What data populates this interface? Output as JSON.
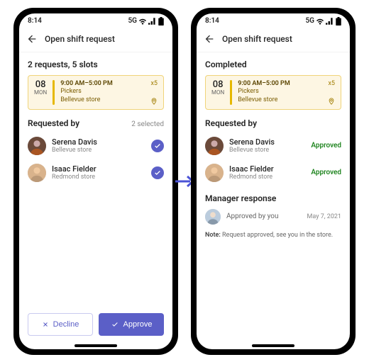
{
  "statusbar": {
    "time": "8:14",
    "network": "5G"
  },
  "header": {
    "title": "Open shift request"
  },
  "shift": {
    "day_num": "08",
    "day_name": "MON",
    "time": "9:00 AM–5:00 PM",
    "role": "Pickers",
    "location": "Bellevue store",
    "count": "x5"
  },
  "left": {
    "summary": "2 requests, 5 slots",
    "requested_by_heading": "Requested by",
    "selected_meta": "2 selected",
    "people": [
      {
        "name": "Serena Davis",
        "sub": "Bellevue store"
      },
      {
        "name": "Isaac Fielder",
        "sub": "Redmond store"
      }
    ],
    "decline_label": "Decline",
    "approve_label": "Approve"
  },
  "right": {
    "summary": "Completed",
    "requested_by_heading": "Requested by",
    "people": [
      {
        "name": "Serena Davis",
        "sub": "Bellevue store",
        "status": "Approved"
      },
      {
        "name": "Isaac Fielder",
        "sub": "Redmond store",
        "status": "Approved"
      }
    ],
    "manager_heading": "Manager response",
    "manager_text": "Approved by you",
    "manager_date": "May 7, 2021",
    "note_label": "Note:",
    "note_text": " Request approved, see you in the store."
  }
}
